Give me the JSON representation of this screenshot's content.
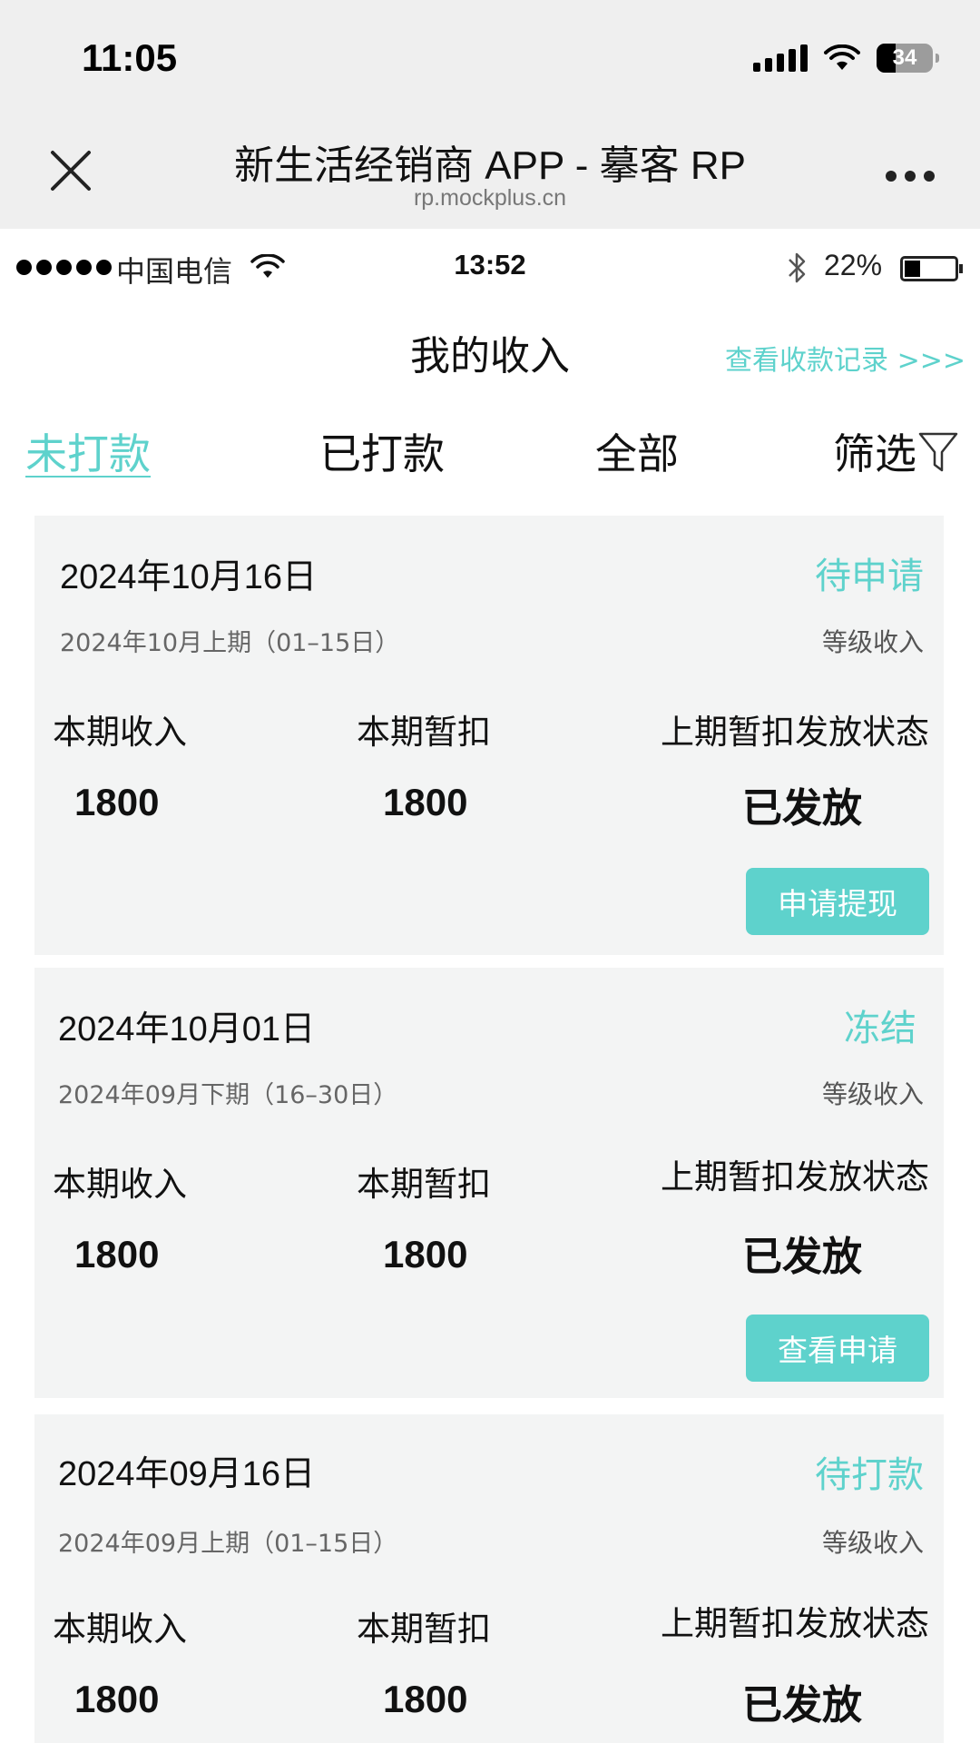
{
  "os_status": {
    "time": "11:05",
    "battery": "34"
  },
  "browser": {
    "title": "新生活经销商 APP - 摹客 RP",
    "url": "rp.mockplus.cn"
  },
  "inner_status": {
    "carrier": "中国电信",
    "time": "13:52",
    "battery_pct": "22%"
  },
  "header": {
    "title": "我的收入",
    "records_link": "查看收款记录 >>>"
  },
  "tabs": [
    {
      "label": "未打款",
      "active": true
    },
    {
      "label": "已打款",
      "active": false
    },
    {
      "label": "全部",
      "active": false
    },
    {
      "label": "筛选",
      "active": false
    }
  ],
  "cards": [
    {
      "date": "2024年10月16日",
      "status": "待申请",
      "period": "2024年10月上期（01–15日）",
      "type": "等级收入",
      "income_label": "本期收入",
      "income": "1800",
      "withhold_label": "本期暂扣",
      "withhold": "1800",
      "release_label": "上期暂扣发放状态",
      "release_status": "已发放",
      "button": "申请提现"
    },
    {
      "date": "2024年10月01日",
      "status": "冻结",
      "period": "2024年09月下期（16–30日）",
      "type": "等级收入",
      "income_label": "本期收入",
      "income": "1800",
      "withhold_label": "本期暂扣",
      "withhold": "1800",
      "release_label": "上期暂扣发放状态",
      "release_status": "已发放",
      "button": "查看申请"
    },
    {
      "date": "2024年09月16日",
      "status": "待打款",
      "period": "2024年09月上期（01–15日）",
      "type": "等级收入",
      "income_label": "本期收入",
      "income": "1800",
      "withhold_label": "本期暂扣",
      "withhold": "1800",
      "release_label": "上期暂扣发放状态",
      "release_status": "已发放"
    }
  ],
  "colors": {
    "accent": "#5ed2cc",
    "card_bg": "#f3f4f4",
    "chrome_bg": "#efefef"
  }
}
